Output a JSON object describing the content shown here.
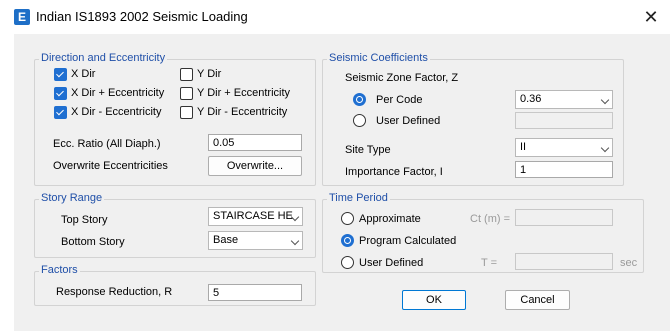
{
  "dialog": {
    "title": "Indian IS1893 2002 Seismic Loading",
    "icon_letter": "E",
    "close_glyph": "✕",
    "accent_color": "#1f6fd1"
  },
  "direction": {
    "title": "Direction and Eccentricity",
    "checkboxes": [
      {
        "label": "X Dir",
        "checked": true
      },
      {
        "label": "Y Dir",
        "checked": false
      },
      {
        "label": "X Dir + Eccentricity",
        "checked": true
      },
      {
        "label": "Y Dir + Eccentricity",
        "checked": false
      },
      {
        "label": "X Dir - Eccentricity",
        "checked": true
      },
      {
        "label": "Y Dir - Eccentricity",
        "checked": false
      }
    ],
    "ecc_label": "Ecc. Ratio (All Diaph.)",
    "ecc_value": "0.05",
    "overwrite_label": "Overwrite Eccentricities",
    "overwrite_button": "Overwrite..."
  },
  "story": {
    "title": "Story Range",
    "top_label": "Top Story",
    "top_value": "STAIRCASE HE",
    "bottom_label": "Bottom Story",
    "bottom_value": "Base"
  },
  "factors": {
    "title": "Factors",
    "r_label": "Response Reduction, R",
    "r_value": "5"
  },
  "seismic": {
    "title": "Seismic Coefficients",
    "zone_label": "Seismic Zone Factor, Z",
    "per_code_label": "Per Code",
    "per_code_selected": true,
    "zone_value": "0.36",
    "user_defined_label": "User Defined",
    "site_label": "Site Type",
    "site_value": "II",
    "importance_label": "Importance Factor, I",
    "importance_value": "1"
  },
  "period": {
    "title": "Time Period",
    "approx_label": "Approximate",
    "ct_label": "Ct (m) =",
    "program_label": "Program Calculated",
    "program_selected": true,
    "user_label": "User Defined",
    "t_label": "T =",
    "sec_label": "sec"
  },
  "buttons": {
    "ok": "OK",
    "cancel": "Cancel"
  }
}
